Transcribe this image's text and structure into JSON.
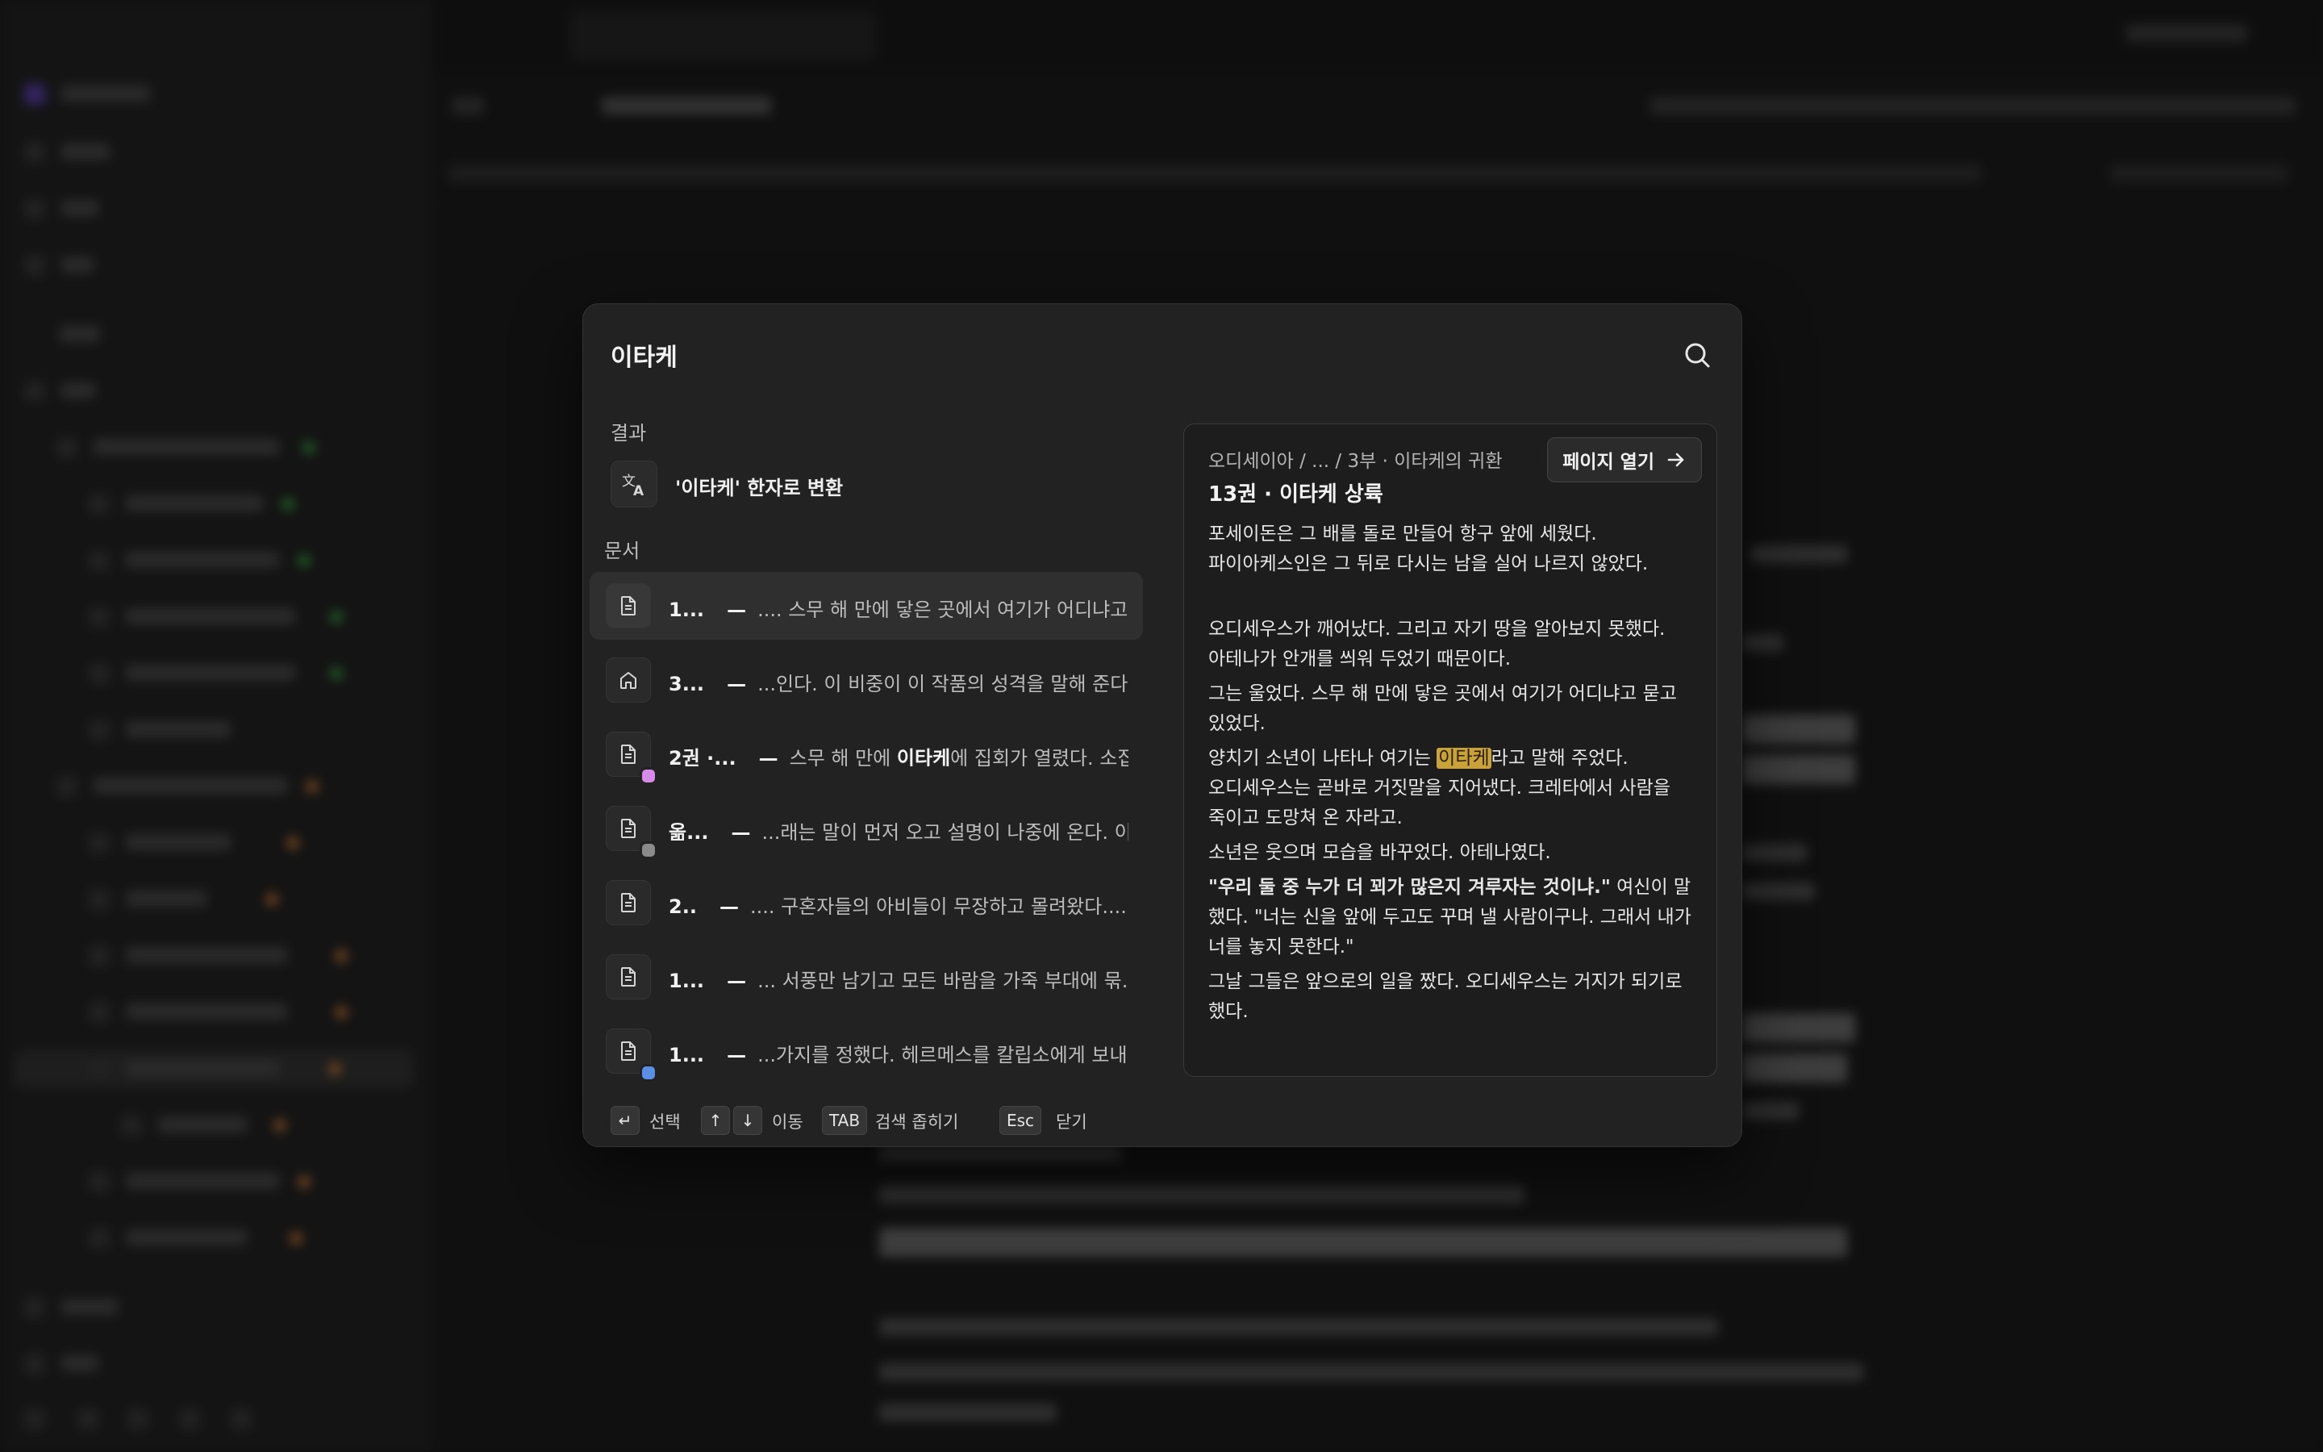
{
  "search": {
    "query": "이타케"
  },
  "results_section": {
    "label": "결과",
    "convert_label": "'이타케' 한자로 변환"
  },
  "documents_section": {
    "label": "문서",
    "items": [
      {
        "title": "1...",
        "separator": "—",
        "snippet_before": ".... 스무 해 만에 닿은 곳에서 여기가 어디냐고...",
        "snippet_match": "",
        "snippet_after": "",
        "icon": "document-icon",
        "dot_color": ""
      },
      {
        "title": "3...",
        "separator": "—",
        "snippet_before": "...인다. 이 비중이 이 작품의 성격을 말해 준다...",
        "snippet_match": "",
        "snippet_after": "",
        "icon": "home-icon",
        "dot_color": ""
      },
      {
        "title": "2권 ·...",
        "separator": "—",
        "snippet_before": "스무 해 만에 ",
        "snippet_match": "이타케",
        "snippet_after": "에 집회가 열렸다. 소집...",
        "icon": "document-icon",
        "dot_color": "#d68be8"
      },
      {
        "title": "옮...",
        "separator": "—",
        "snippet_before": "...래는 말이 먼저 오고 설명이 나중에 온다. 이...",
        "snippet_match": "",
        "snippet_after": "",
        "icon": "document-icon",
        "dot_color": "#8a8a8a"
      },
      {
        "title": "2..",
        "separator": "—",
        "snippet_before": ".... 구혼자들의 아비들이 무장하고 몰려왔다....",
        "snippet_match": "",
        "snippet_after": "",
        "icon": "document-icon",
        "dot_color": ""
      },
      {
        "title": "1...",
        "separator": "—",
        "snippet_before": "... 서풍만 남기고 모든 바람을 가죽 부대에 묶...",
        "snippet_match": "",
        "snippet_after": "",
        "icon": "document-icon",
        "dot_color": ""
      },
      {
        "title": "1...",
        "separator": "—",
        "snippet_before": "...가지를 정했다. 헤르메스를 칼립소에게 보내...",
        "snippet_match": "",
        "snippet_after": "",
        "icon": "document-icon",
        "dot_color": "#5b8fe6"
      }
    ]
  },
  "preview": {
    "breadcrumb": "오디세이아 / ... / 3부 · 이타케의 귀환",
    "title": "13권 · 이타케 상륙",
    "open_label": "페이지 열기",
    "paragraphs": [
      {
        "lines": [
          "포세이돈은 그 배를 돌로 만들어 항구 앞에 세웠다.",
          "파이아케스인은 그 뒤로 다시는 남을 실어 나르지 않았다."
        ]
      },
      {
        "lines": [
          "오디세우스가 깨어났다. 그리고 자기 땅을 알아보지 못했다.",
          "아테나가 안개를 씌워 두었기 때문이다."
        ]
      },
      {
        "text": "그는 울었다. 스무 해 만에 닿은 곳에서 여기가 어디냐고 묻고 있었다."
      },
      {
        "before": "양치기 소년이 나타나 여기는 ",
        "match": "이타케",
        "after": "라고 말해 주었다.",
        "rest": "오디세우스는 곧바로 거짓말을 지어냈다. 크레타에서 사람을 죽이고 도망쳐 온 자라고."
      },
      {
        "text": "소년은 웃으며 모습을 바꾸었다. 아테나였다."
      },
      {
        "bold": "\"우리 둘 중 누가 더 꾀가 많은지 겨루자는 것이냐.\"",
        "after": " 여신이 말했다. \"너는 신을 앞에 두고도 꾸며 낼 사람이구나. 그래서 내가 너를 놓지 못한다.\""
      },
      {
        "text": "그날 그들은 앞으로의 일을 짰다. 오디세우스는 거지가 되기로 했다."
      }
    ]
  },
  "footer": {
    "select_key": "↵",
    "select_label": "선택",
    "up_key": "↑",
    "down_key": "↓",
    "move_label": "이동",
    "tab_key": "TAB",
    "tab_label": "검색 좁히기",
    "esc_key": "Esc",
    "esc_label": "닫기"
  },
  "colors": {
    "highlight": "#c9a23a",
    "modal_bg": "#222222",
    "accent_green": "#3fb950",
    "accent_orange": "#e8893a"
  }
}
